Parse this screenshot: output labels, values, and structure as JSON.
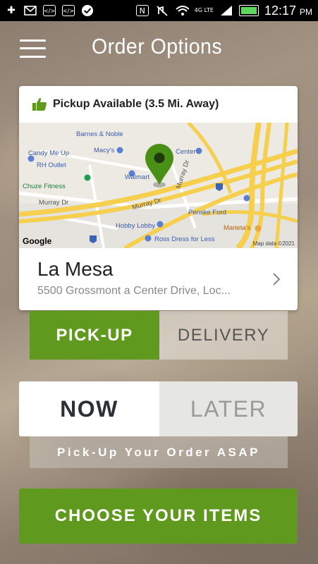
{
  "status_bar": {
    "time": "12:17",
    "ampm": "PM",
    "network": "4G LTE",
    "icons": [
      "plus-icon",
      "gmail-icon",
      "code-icon",
      "code-icon",
      "check-icon",
      "nfc-icon",
      "mute-icon",
      "wifi-icon",
      "signal-icon",
      "battery-icon"
    ]
  },
  "header": {
    "title": "Order Options"
  },
  "pickup": {
    "availability": "Pickup Available (3.5 Mi. Away)"
  },
  "map": {
    "labels": {
      "barnes": "Barnes & Noble",
      "candy": "Candy Me Up",
      "macys": "Macy's",
      "rh": "RH Outlet",
      "center": "Center",
      "walmart": "Walmart",
      "murray_dr_1": "Murray Dr",
      "murray_dr_2": "Murray Dr",
      "murray_dr_3": "Murray Dr",
      "chuze": "Chuze Fitness",
      "penske": "Penske Ford",
      "hobby": "Hobby Lobby",
      "marietas": "Marieta's",
      "ross": "Ross Dress for Less",
      "hwy": "8",
      "hwy2": "8"
    },
    "google": "Google",
    "map_data": "Map data ©2021"
  },
  "location": {
    "name": "La Mesa",
    "address": "5500 Grossmont a Center Drive, Loc..."
  },
  "order_type": {
    "options": [
      "PICK-UP",
      "DELIVERY"
    ],
    "selected": "PICK-UP"
  },
  "timing": {
    "options": [
      "NOW",
      "LATER"
    ],
    "selected": "NOW",
    "note": "Pick-Up Your Order ASAP"
  },
  "cta": {
    "label": "CHOOSE YOUR ITEMS"
  },
  "colors": {
    "accent_green": "#5f9a1e",
    "map_pin_green": "#4a8f16"
  }
}
